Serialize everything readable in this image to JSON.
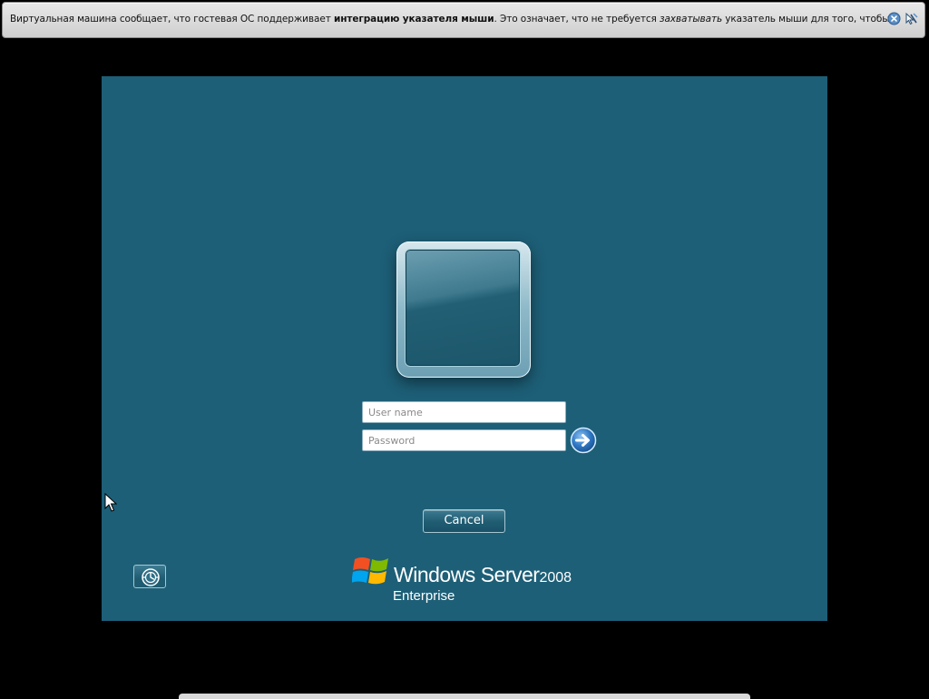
{
  "notification": {
    "text_prefix": "Виртуальная машина сообщает, что гостевая ОС поддерживает ",
    "text_bold": "интеграцию указателя мыши",
    "text_middle": ". Это означает, что не требуется ",
    "text_italic": "захватывать",
    "text_suffix": " указатель мыши для того, чтобы",
    "close_icon": "close-circle-icon",
    "dismiss_icon": "mouse-integration-off-icon"
  },
  "login": {
    "username_placeholder": "User name",
    "password_placeholder": "Password",
    "submit_icon": "arrow-right-icon",
    "cancel_label": "Cancel",
    "ease_of_access_icon": "ease-of-access-icon"
  },
  "brand": {
    "name": "Windows Server",
    "version": "2008",
    "edition": "Enterprise",
    "logo_icon": "windows-flag-icon"
  },
  "colors": {
    "screen_background": "#1d5f77",
    "outer_background": "#000000",
    "notification_background": "#d9d9d9"
  }
}
